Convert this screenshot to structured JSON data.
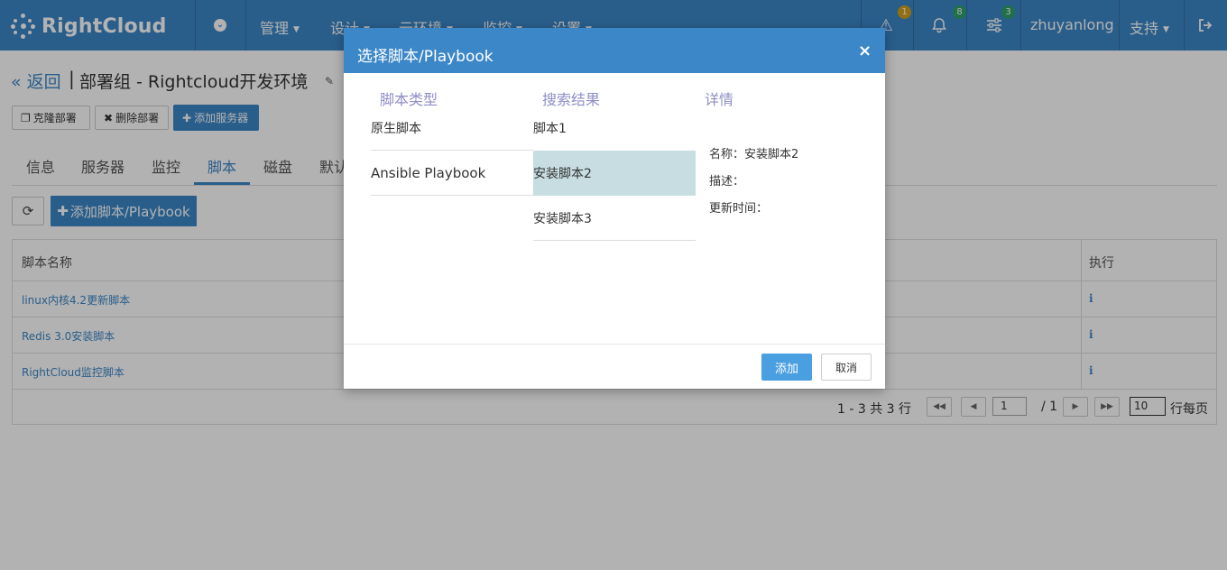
{
  "colors": {
    "brand": "#3c87c8",
    "selected_row": "#c7dde2",
    "column_header": "#8f8fc6",
    "overlay": "rgba(0,0,0,0.30)",
    "badge_warning": "#d4a017",
    "badge_notify": "#2ea36b"
  },
  "topbar": {
    "logo_text": "RightCloud",
    "nav": [
      {
        "label": "管理"
      },
      {
        "label": "设计"
      },
      {
        "label": "云环境"
      },
      {
        "label": "监控"
      },
      {
        "label": "设置"
      }
    ],
    "warning_badge": "1",
    "bell_badge": "8",
    "sliders_badge": "3",
    "username": "zhuyanlong",
    "support": "支持"
  },
  "page": {
    "back": "« 返回",
    "pipe": "|",
    "title": "部署组 - Rightcloud开发环境",
    "buttons": {
      "clone": "克隆部署",
      "delete": "删除部署",
      "add_server": "添加服务器"
    },
    "tabs": [
      "信息",
      "服务器",
      "监控",
      "脚本",
      "磁盘",
      "默认"
    ],
    "active_tab": "脚本",
    "add_script": "添加脚本/Playbook",
    "table": {
      "col_name": "脚本名称",
      "col_exec": "执行",
      "rows": [
        {
          "name": "linux内核4.2更新脚本"
        },
        {
          "name": "Redis 3.0安装脚本"
        },
        {
          "name": "RightCloud监控脚本"
        }
      ],
      "info_icon": "i"
    },
    "pager": {
      "range": "1 - 3 共 3 行",
      "page_value": "1",
      "page_total": "/ 1",
      "page_size": "10",
      "per_page": "行每页"
    }
  },
  "modal": {
    "title": "选择脚本/Playbook",
    "close": "×",
    "columns": {
      "type": "脚本类型",
      "results": "搜索结果",
      "detail": "详情"
    },
    "types": [
      "原生脚本",
      "Ansible Playbook"
    ],
    "results": [
      "脚本1",
      "安装脚本2",
      "安装脚本3"
    ],
    "selected_result": "安装脚本2",
    "detail": {
      "name": "名称：安装脚本2",
      "desc": "描述：",
      "updated": "更新时间："
    },
    "add": "添加",
    "cancel": "取消"
  }
}
